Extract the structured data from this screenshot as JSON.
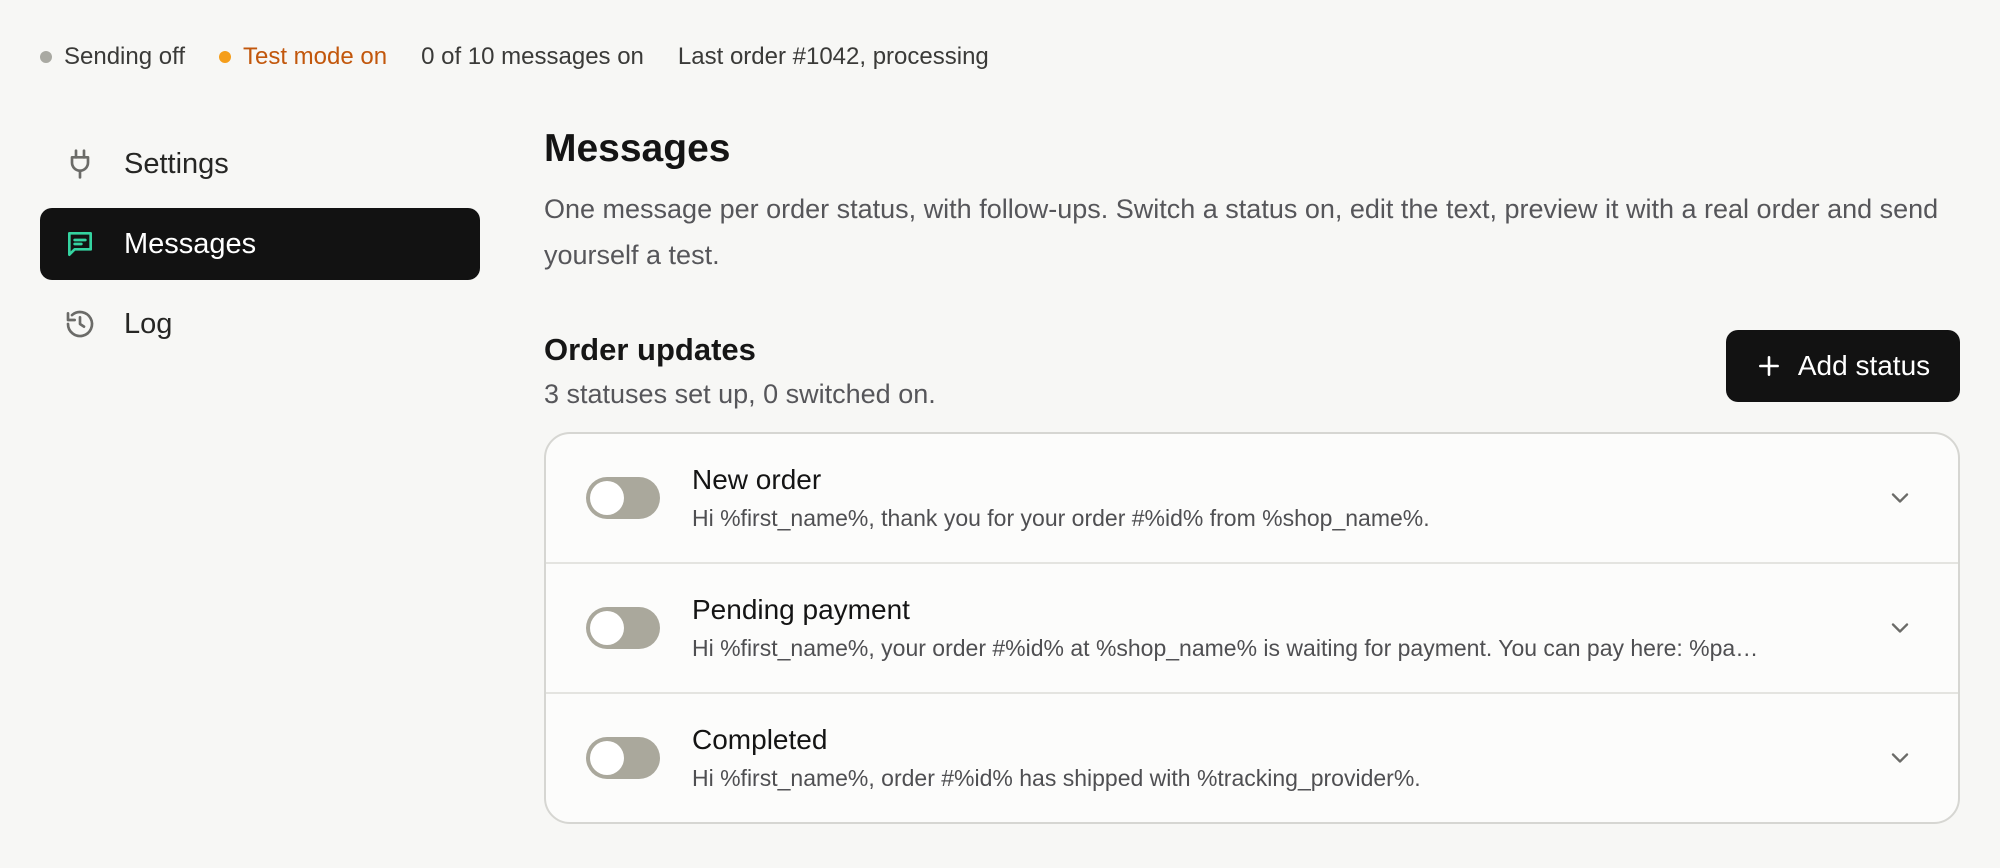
{
  "status_bar": {
    "sending": "Sending off",
    "test_mode": "Test mode on",
    "messages_count": "0 of 10 messages on",
    "last_order": "Last order #1042, processing"
  },
  "colors": {
    "sending_dot": "#a9a9a2",
    "test_mode_dot": "#f59e1b",
    "test_mode_text": "#c2570c",
    "active_nav_bg": "#121212",
    "active_icon": "#34d3a0"
  },
  "sidebar": {
    "items": [
      {
        "label": "Settings",
        "icon": "plug-icon",
        "active": false
      },
      {
        "label": "Messages",
        "icon": "message-icon",
        "active": true
      },
      {
        "label": "Log",
        "icon": "history-icon",
        "active": false
      }
    ]
  },
  "main": {
    "title": "Messages",
    "description": "One message per order status, with follow-ups. Switch a status on, edit the text, preview it with a real order and send yourself a test.",
    "section": {
      "title": "Order updates",
      "subtitle": "3 statuses set up, 0 switched on.",
      "add_button": "Add status"
    },
    "statuses": [
      {
        "name": "New order",
        "message": "Hi %first_name%, thank you for your order #%id% from %shop_name%.",
        "enabled": false
      },
      {
        "name": "Pending payment",
        "message": "Hi %first_name%, your order #%id% at %shop_name% is waiting for payment. You can pay here: %pa…",
        "enabled": false
      },
      {
        "name": "Completed",
        "message": "Hi %first_name%, order #%id% has shipped with %tracking_provider%.",
        "enabled": false
      }
    ]
  }
}
